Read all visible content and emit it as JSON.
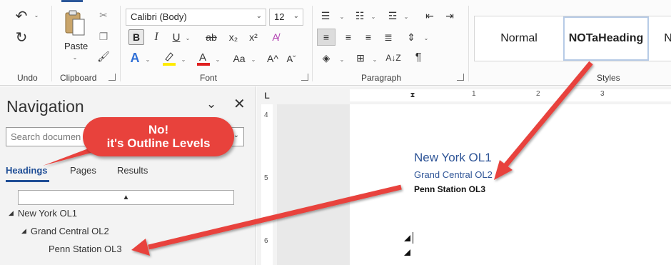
{
  "ribbon": {
    "undo_label": "Undo",
    "clipboard_label": "Clipboard",
    "paste_label": "Paste",
    "font_label": "Font",
    "paragraph_label": "Paragraph",
    "styles_label": "Styles",
    "font_name": "Calibri (Body)",
    "font_size": "12",
    "styles": [
      "Normal",
      "NOTaHeading",
      "N"
    ]
  },
  "navigation": {
    "title": "Navigation",
    "search_placeholder": "Search documen",
    "tabs": [
      "Headings",
      "Pages",
      "Results"
    ],
    "tree": [
      "New York OL1",
      "Grand Central OL2",
      "Penn Station OL3"
    ]
  },
  "callout": {
    "line1": "No!",
    "line2": "it's Outline Levels"
  },
  "ruler": {
    "h_numbers": [
      "1",
      "2",
      "3"
    ],
    "v_numbers": [
      "4",
      "5",
      "6"
    ]
  },
  "document": {
    "h1": "New York OL1",
    "h2": "Grand Central OL2",
    "h3": "Penn Station OL3"
  },
  "colors": {
    "accent": "#2b579a",
    "heading_blue": "#2f5597",
    "callout_red": "#e8423c"
  }
}
